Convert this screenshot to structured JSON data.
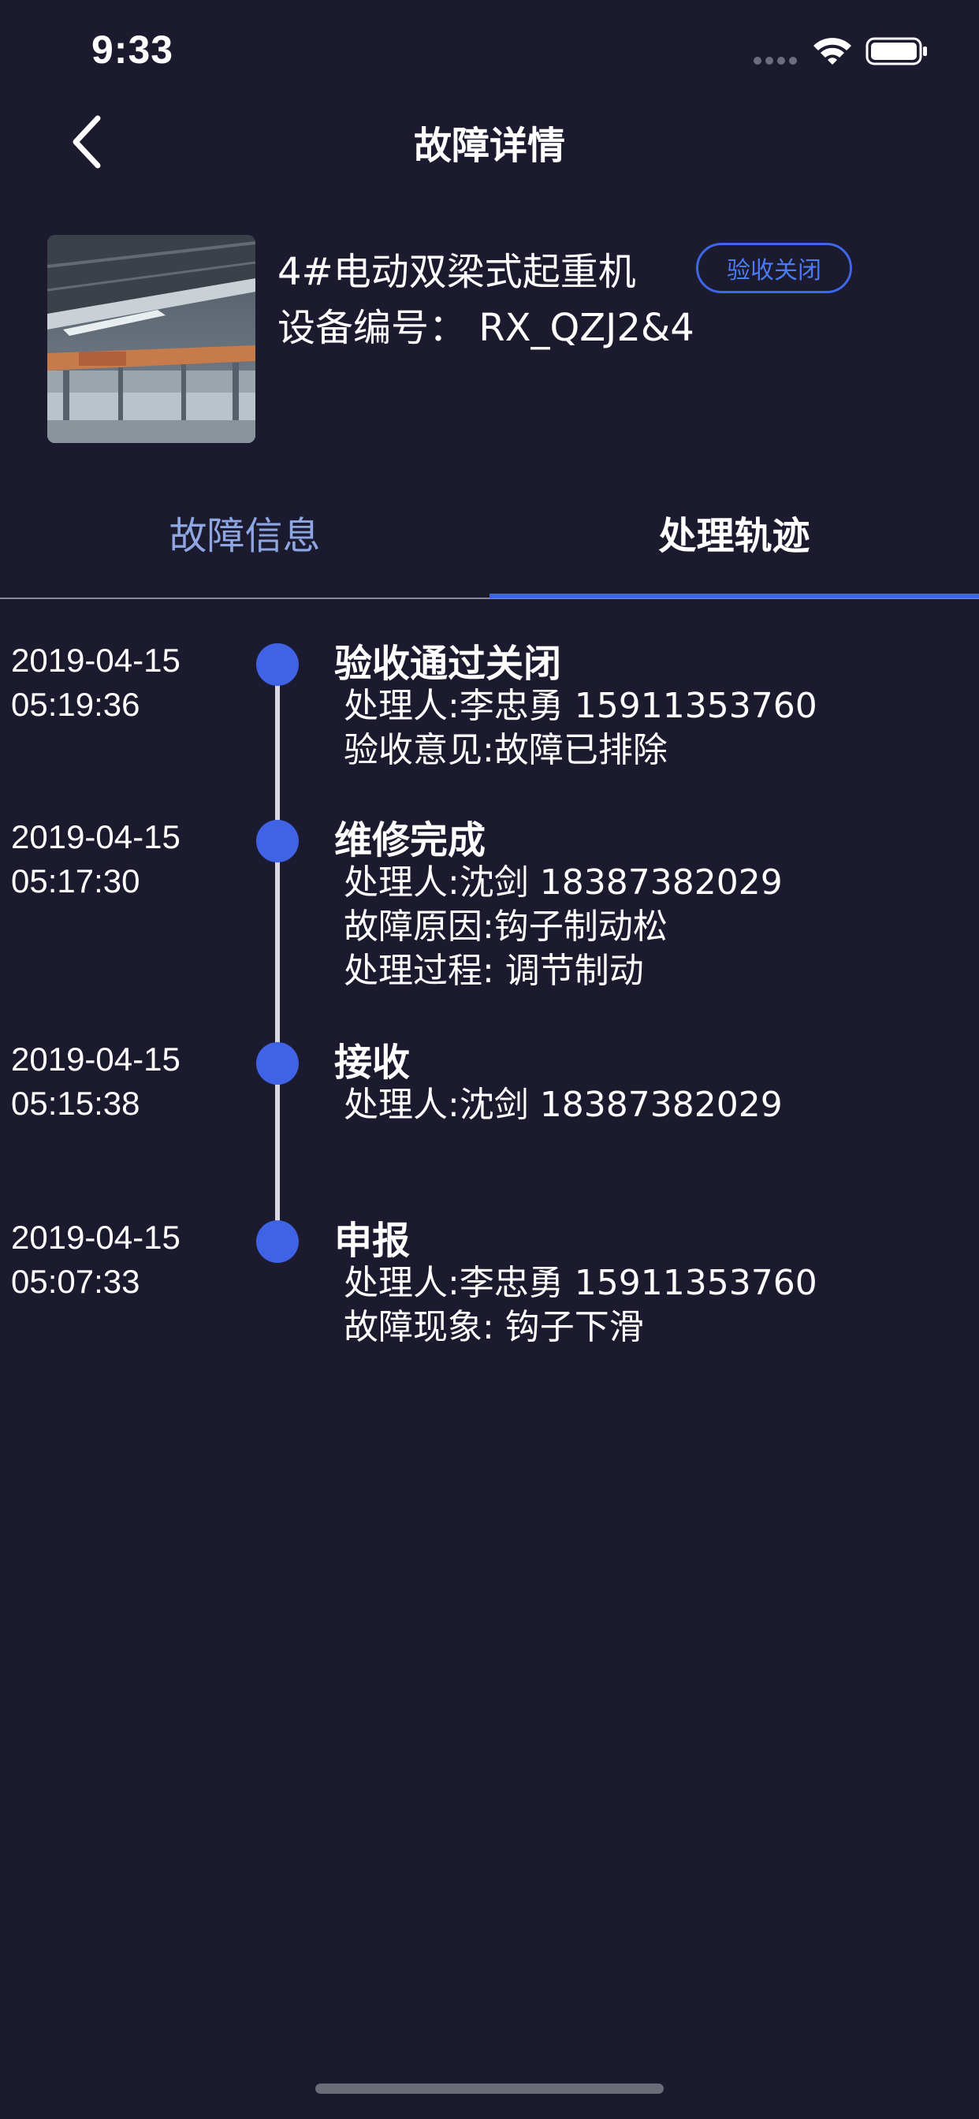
{
  "status_bar": {
    "time": "9:33"
  },
  "nav": {
    "title": "故障详情"
  },
  "device": {
    "name": "4#电动双梁式起重机",
    "status_badge": "验收关闭",
    "code": "设备编号：  RX_QZJ2&4"
  },
  "tabs": [
    {
      "label": "故障信息",
      "active": false
    },
    {
      "label": "处理轨迹",
      "active": true
    }
  ],
  "timeline": [
    {
      "date": "2019-04-15",
      "time": "05:19:36",
      "title": "验收通过关闭",
      "lines": [
        "处理人:李忠勇 15911353760",
        "验收意见:故障已排除"
      ]
    },
    {
      "date": "2019-04-15",
      "time": "05:17:30",
      "title": "维修完成",
      "lines": [
        "处理人:沈剑 18387382029",
        "故障原因:钩子制动松",
        "处理过程: 调节制动"
      ]
    },
    {
      "date": "2019-04-15",
      "time": "05:15:38",
      "title": "接收",
      "lines": [
        "处理人:沈剑 18387382029"
      ]
    },
    {
      "date": "2019-04-15",
      "time": "05:07:33",
      "title": "申报",
      "lines": [
        "处理人:李忠勇 15911353760",
        "故障现象: 钩子下滑"
      ]
    }
  ],
  "colors": {
    "background": "#1b1a2e",
    "accent": "#3d66e8",
    "tab_inactive": "#8ea6e2"
  }
}
